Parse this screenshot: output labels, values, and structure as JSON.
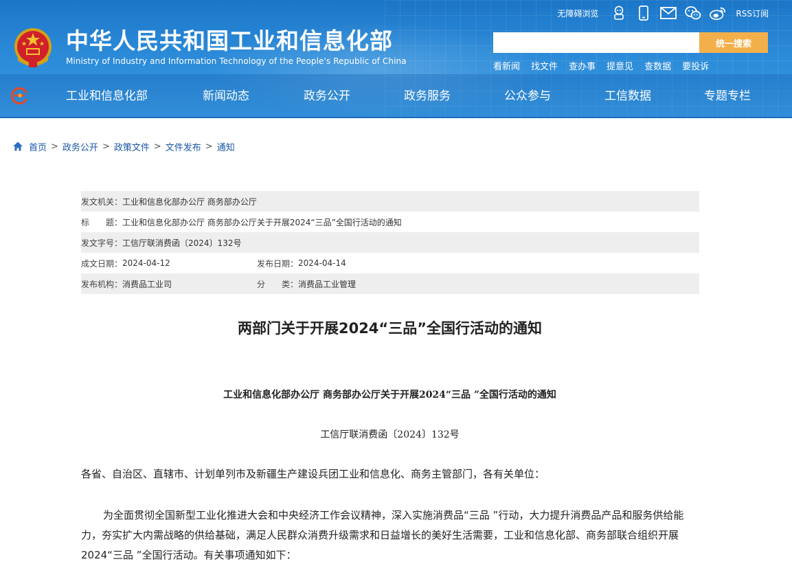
{
  "header": {
    "title_cn": "中华人民共和国工业和信息化部",
    "title_en": "Ministry of Industry and Information Technology of the People's Republic of China",
    "toplinks": {
      "accessibility": "无障碍浏览",
      "icons": [
        "robot-icon",
        "mobile-icon",
        "mail-icon",
        "wechat-icon",
        "weibo-icon"
      ],
      "rss": "RSS订阅"
    },
    "search": {
      "placeholder": "",
      "button": "统一搜索"
    },
    "quicklinks": [
      "看新闻",
      "找文件",
      "查办事",
      "提意见",
      "查数据",
      "要投诉"
    ],
    "nav": [
      "工业和信息化部",
      "新闻动态",
      "政务公开",
      "政务服务",
      "公众参与",
      "工信数据",
      "专题专栏"
    ]
  },
  "breadcrumb": {
    "home": "首页",
    "items": [
      "政务公开",
      "政策文件",
      "文件发布",
      "通知"
    ],
    "separator": ">"
  },
  "meta": {
    "issuer_label": "发文机关：",
    "issuer": "工业和信息化部办公厅 商务部办公厅",
    "title_label": "标　　题：",
    "title": "工业和信息化部办公厅 商务部办公厅关于开展2024“三品”全国行活动的通知",
    "docno_label": "发文字号：",
    "docno": "工信厅联消费函〔2024〕132号",
    "created_label": "成文日期：",
    "created": "2024-04-12",
    "published_label": "发布日期：",
    "published": "2024-04-14",
    "org_label": "发布机构：",
    "org": "消费品工业司",
    "category_label": "分　　类：",
    "category": "消费品工业管理"
  },
  "article": {
    "headline": "两部门关于开展2024“三品”全国行活动的通知",
    "doc_title": "工业和信息化部办公厅  商务部办公厅关于开展2024“三品 ”全国行活动的通知",
    "doc_number": "工信厅联消费函〔2024〕132号",
    "addressee": "各省、自治区、直辖市、计划单列市及新疆生产建设兵团工业和信息化、商务主管部门，各有关单位：",
    "body": "为全面贯彻全国新型工业化推进大会和中央经济工作会议精神，深入实施消费品“三品 ”行动，大力提升消费品产品和服务供给能力，夯实扩大内需战略的供给基础，满足人民群众消费升级需求和日益增长的美好生活需要，工业和信息化部、商务部联合组织开展2024“三品 ”全国行活动。有关事项通知如下："
  },
  "colors": {
    "header_blue": "#2b8ad8",
    "search_button": "#f3b04a",
    "link_blue": "#1a56a6",
    "meta_shade": "#eeeeee"
  }
}
